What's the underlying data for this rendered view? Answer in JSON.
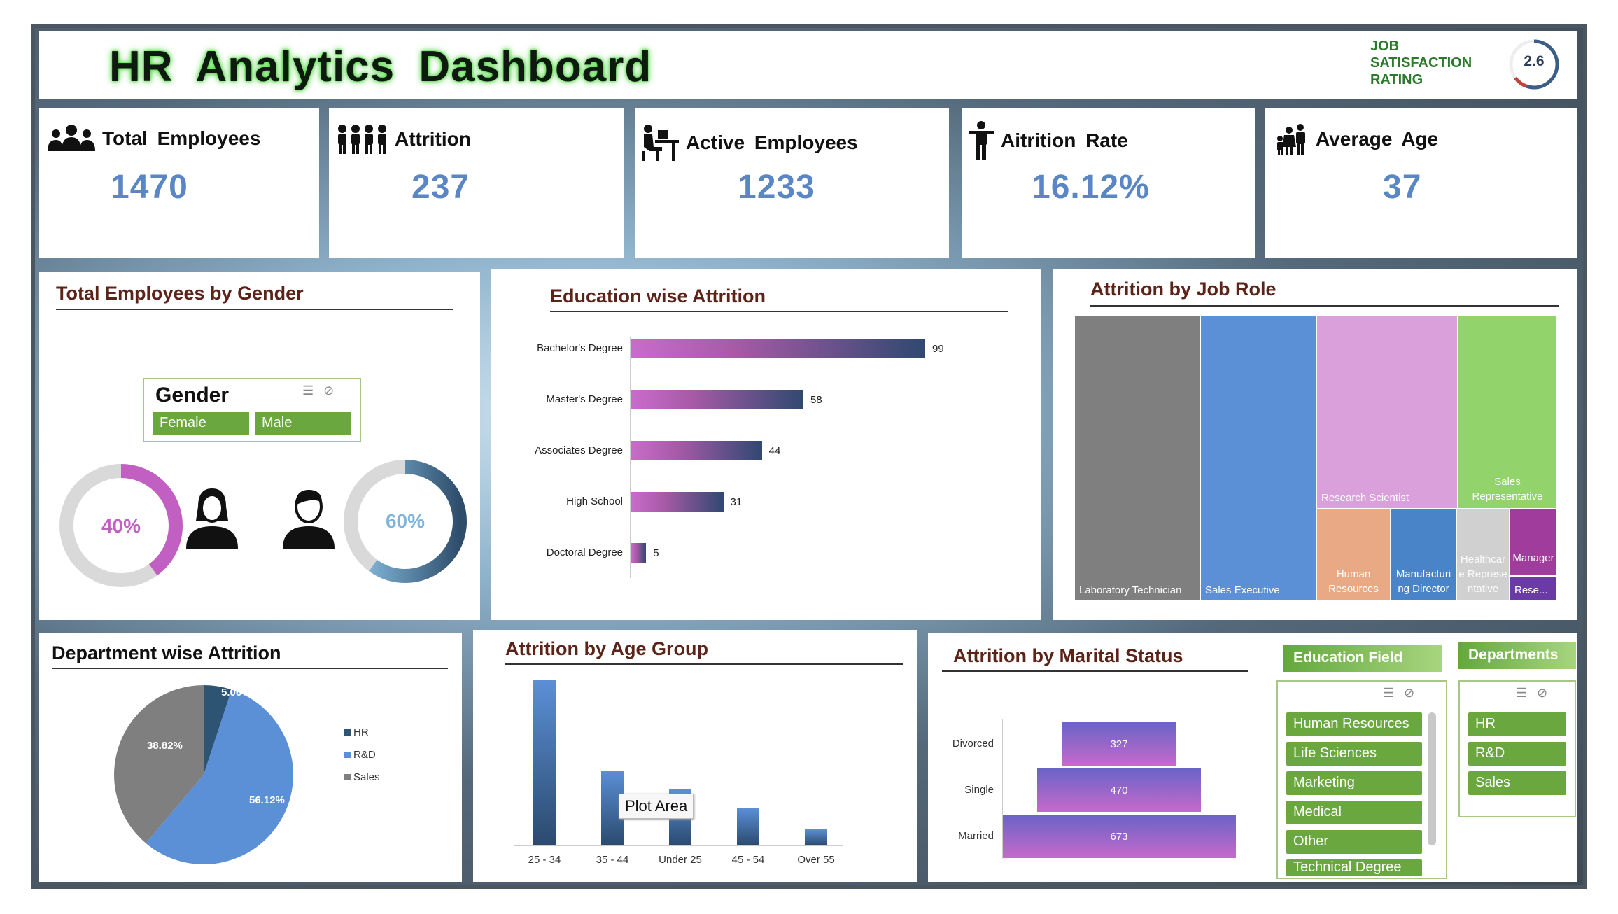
{
  "header": {
    "title": "HR  Analytics  Dashboard",
    "job_satisfaction_label": "JOB SATISFACTION RATING",
    "job_satisfaction_value": "2.6",
    "job_satisfaction_fraction": 0.65
  },
  "kpis": {
    "total_employees": {
      "label": "Total  Employees",
      "value": "1470",
      "icon": "group-icon"
    },
    "attrition": {
      "label": "Attrition",
      "value": "237",
      "icon": "people-row-icon"
    },
    "active_employees": {
      "label": "Active  Employees",
      "value": "1233",
      "icon": "desk-worker-icon"
    },
    "attrition_rate": {
      "label": "Aitrition  Rate",
      "value": "16.12%",
      "icon": "person-icon"
    },
    "average_age": {
      "label": "Average  Age",
      "value": "37",
      "icon": "family-icon"
    }
  },
  "gender": {
    "section_title": "Total Employees by Gender",
    "slicer_title": "Gender",
    "options": [
      "Female",
      "Male"
    ],
    "female_pct": "40%",
    "male_pct": "60%",
    "female_fraction": 0.4,
    "male_fraction": 0.6,
    "colors": {
      "female": "#c25fc2",
      "male": "#4a7fa6",
      "track": "#d9d9d9"
    }
  },
  "education": {
    "section_title": "Education wise Attrition"
  },
  "job_role": {
    "section_title": "Attrition by Job Role",
    "tiles": [
      {
        "label": "Laboratory Technician",
        "color": "#7f7f7f"
      },
      {
        "label": "Sales Executive",
        "color": "#5b8fd6"
      },
      {
        "label": "Research Scientist",
        "color": "#d9a0dc"
      },
      {
        "label": "Sales Representative",
        "color": "#92d36c"
      },
      {
        "label": "Human Resources",
        "color": "#e9a984"
      },
      {
        "label": "Manufacturing Director",
        "color": "#4a84c8"
      },
      {
        "label": "Healthcare Representative",
        "color": "#d0d0d0"
      },
      {
        "label": "Manager",
        "color": "#a03c9c"
      },
      {
        "label": "Rese...",
        "color": "#6a3aa5"
      }
    ]
  },
  "department": {
    "section_title": "Department wise Attrition"
  },
  "age_group": {
    "section_title": "Attrition by Age Group",
    "tooltip": "Plot Area"
  },
  "marital": {
    "section_title": "Attrition by Marital Status"
  },
  "education_field_slicer": {
    "title": "Education Field",
    "options": [
      "Human Resources",
      "Life Sciences",
      "Marketing",
      "Medical",
      "Other",
      "Technical Degree"
    ]
  },
  "departments_slicer": {
    "title": "Departments",
    "options": [
      "HR",
      "R&D",
      "Sales"
    ]
  },
  "chart_data": [
    {
      "type": "bar",
      "orientation": "horizontal",
      "categories": [
        "Bachelor's Degree",
        "Master's Degree",
        "Associates Degree",
        "High School",
        "Doctoral Degree"
      ],
      "values": [
        99,
        58,
        44,
        31,
        5
      ]
    },
    {
      "type": "pie",
      "categories": [
        "HR",
        "R&D",
        "Sales"
      ],
      "values": [
        5.06,
        56.12,
        38.82
      ],
      "data_labels": [
        "5.06%",
        "56.12%",
        "38.82%"
      ],
      "colors": [
        "#2d5473",
        "#5b8fd6",
        "#7f7f7f"
      ],
      "legend": "right"
    },
    {
      "type": "bar",
      "categories": [
        "25 - 34",
        "35 - 44",
        "Under 25",
        "45 - 54",
        "Over 55"
      ],
      "values": [
        112,
        51,
        38,
        25,
        11
      ]
    },
    {
      "type": "bar",
      "orientation": "horizontal",
      "style": "funnel",
      "categories": [
        "Divorced",
        "Single",
        "Married"
      ],
      "values": [
        327,
        470,
        673
      ]
    }
  ]
}
